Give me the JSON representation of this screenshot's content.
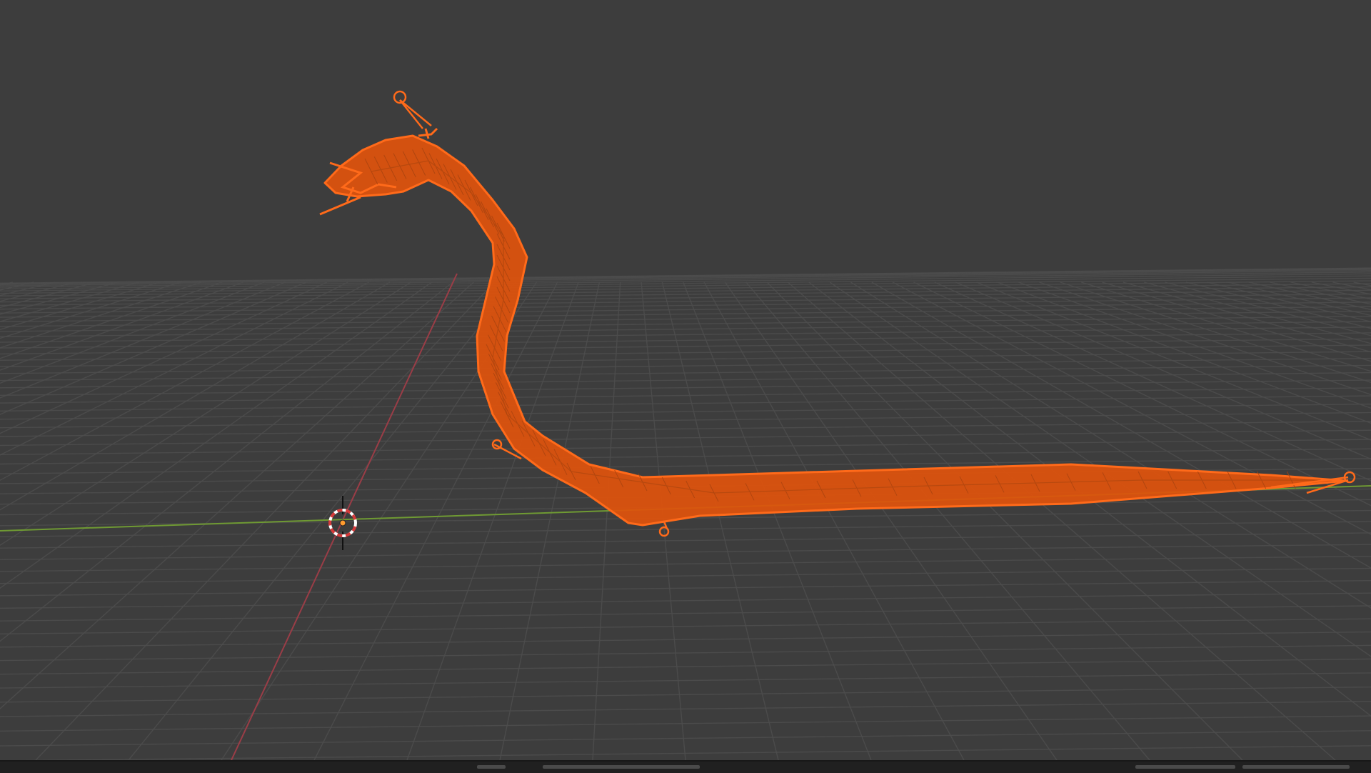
{
  "app": "3D viewport",
  "viewport": {
    "background_color": "#3d3d3d",
    "grid_color": "#4d4d4d",
    "x_axis_color": "#9a3d47",
    "y_axis_color": "#6f9a33"
  },
  "object": {
    "kind": "serpent mesh with armature",
    "state": "selected",
    "outline_color": "#ff6a1a",
    "wire_color": "#e0520c"
  },
  "cursor": {
    "icon": "3d-cursor-icon"
  }
}
